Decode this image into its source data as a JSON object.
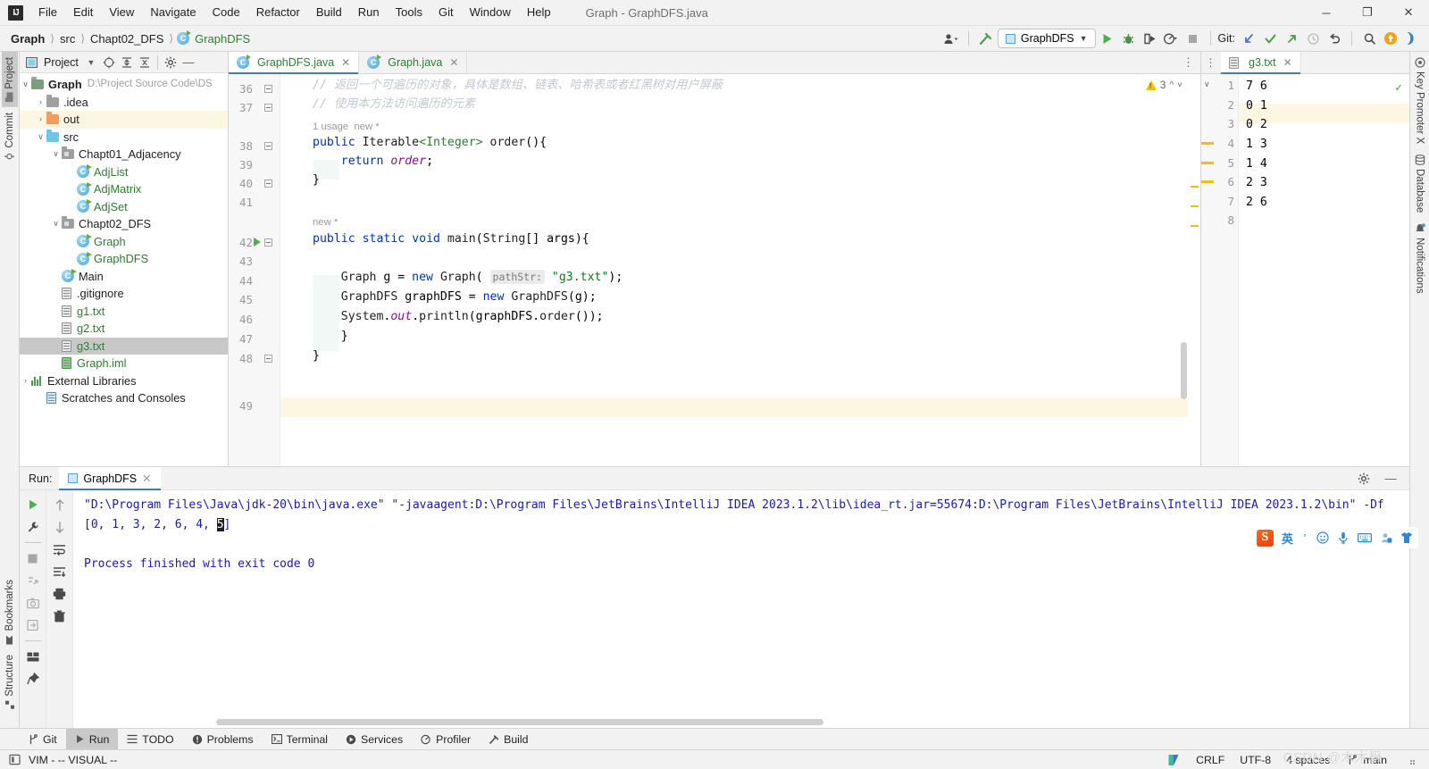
{
  "window": {
    "title": "Graph - GraphDFS.java",
    "logo": "IJ",
    "controls": {
      "minimize": "─",
      "maximize": "❐",
      "close": "✕"
    }
  },
  "menu": [
    "File",
    "Edit",
    "View",
    "Navigate",
    "Code",
    "Refactor",
    "Build",
    "Run",
    "Tools",
    "Git",
    "Window",
    "Help"
  ],
  "breadcrumb": {
    "project": "Graph",
    "src": "src",
    "package": "Chapt02_DFS",
    "class": "GraphDFS"
  },
  "toolbar": {
    "run_config": "GraphDFS",
    "git_label": "Git:",
    "icons": [
      "user-avatar-icon",
      "build-hammer-icon",
      "run-icon",
      "debug-icon",
      "run-with-coverage-icon",
      "profiler-icon",
      "stop-icon",
      "git-update-icon",
      "git-commit-icon",
      "git-push-icon",
      "history-icon",
      "rollback-icon",
      "search-everywhere-icon",
      "update-icon",
      "ide-assistant-icon"
    ]
  },
  "left_stripe": [
    {
      "label": "Project",
      "icon": "project-folder-icon",
      "selected": true
    },
    {
      "label": "Commit",
      "icon": "commit-icon",
      "selected": false
    },
    {
      "label": "Bookmarks",
      "icon": "bookmark-icon",
      "selected": false
    },
    {
      "label": "Structure",
      "icon": "structure-icon",
      "selected": false
    }
  ],
  "right_stripe": [
    {
      "label": "Key Promoter X",
      "icon": "key-promoter-icon"
    },
    {
      "label": "Database",
      "icon": "database-icon"
    },
    {
      "label": "Notifications",
      "icon": "notifications-bell-icon"
    }
  ],
  "project_panel": {
    "title": "Project",
    "toolbar_icons": [
      "select-opened-file-icon",
      "expand-all-icon",
      "collapse-all-icon",
      "settings-gear-icon",
      "hide-icon"
    ],
    "tree": [
      {
        "label": "Graph",
        "detail": "D:\\Project Source Code\\DS",
        "kind": "project-root",
        "indent": 0,
        "arrow": "∨",
        "bold": true
      },
      {
        "label": ".idea",
        "kind": "folder-gray",
        "indent": 1,
        "arrow": "›"
      },
      {
        "label": "out",
        "kind": "folder-orange",
        "indent": 1,
        "arrow": "›",
        "highlight": true
      },
      {
        "label": "src",
        "kind": "folder-src",
        "indent": 1,
        "arrow": "∨"
      },
      {
        "label": "Chapt01_Adjacency",
        "kind": "package",
        "indent": 2,
        "arrow": "∨"
      },
      {
        "label": "AdjList",
        "kind": "class",
        "indent": 3
      },
      {
        "label": "AdjMatrix",
        "kind": "class",
        "indent": 3
      },
      {
        "label": "AdjSet",
        "kind": "class",
        "indent": 3
      },
      {
        "label": "Chapt02_DFS",
        "kind": "package",
        "indent": 2,
        "arrow": "∨"
      },
      {
        "label": "Graph",
        "kind": "class",
        "indent": 3
      },
      {
        "label": "GraphDFS",
        "kind": "class",
        "indent": 3
      },
      {
        "label": "Main",
        "kind": "class",
        "indent": 2
      },
      {
        "label": ".gitignore",
        "kind": "gitignore-file",
        "indent": 2
      },
      {
        "label": "g1.txt",
        "kind": "text-file",
        "indent": 2
      },
      {
        "label": "g2.txt",
        "kind": "text-file",
        "indent": 2
      },
      {
        "label": "g3.txt",
        "kind": "text-file",
        "indent": 2,
        "selected": true
      },
      {
        "label": "Graph.iml",
        "kind": "iml-file",
        "indent": 2
      },
      {
        "label": "External Libraries",
        "kind": "libraries",
        "indent": 0,
        "arrow": "›"
      },
      {
        "label": "Scratches and Consoles",
        "kind": "scratches",
        "indent": 0
      }
    ]
  },
  "editor": {
    "tabs": [
      {
        "label": "GraphDFS.java",
        "active": true
      },
      {
        "label": "Graph.java",
        "active": false
      }
    ],
    "warning_count": "3",
    "lines": [
      {
        "num": "36",
        "text": "// 返回一个可遍历的对象，具体是数组、链表、哈希表或者红黑树对用户屏蔽"
      },
      {
        "num": "37",
        "text": "// 使用本方法访问遍历的元素"
      },
      {
        "num": "38",
        "text": "public Iterable<Integer> order(){"
      },
      {
        "num": "39",
        "text": "    return order;"
      },
      {
        "num": "40",
        "text": "}"
      },
      {
        "num": "41",
        "text": ""
      },
      {
        "num": "42",
        "text": "public static void main(String[] args){"
      },
      {
        "num": "43",
        "text": ""
      },
      {
        "num": "44",
        "text": "    Graph g = new Graph( pathStr: \"g3.txt\");"
      },
      {
        "num": "45",
        "text": "    GraphDFS graphDFS = new GraphDFS(g);"
      },
      {
        "num": "46",
        "text": "    System.out.println(graphDFS.order());"
      },
      {
        "num": "47",
        "text": "    }"
      },
      {
        "num": "48",
        "text": "}"
      },
      {
        "num": "49",
        "text": ""
      }
    ],
    "inlay_usage": "1 usage",
    "inlay_new": "new *",
    "inlay_new2": "new *",
    "param_hint": "pathStr:"
  },
  "right_editor": {
    "tab": "g3.txt",
    "lines": [
      {
        "num": "1",
        "text": "7 6"
      },
      {
        "num": "2",
        "text": "0 1"
      },
      {
        "num": "3",
        "text": "0 2",
        "highlight": true
      },
      {
        "num": "4",
        "text": "1 3"
      },
      {
        "num": "5",
        "text": "1 4"
      },
      {
        "num": "6",
        "text": "2 3"
      },
      {
        "num": "7",
        "text": "2 6"
      },
      {
        "num": "8",
        "text": ""
      }
    ]
  },
  "run_panel": {
    "label": "Run:",
    "tab": "GraphDFS",
    "left_icons": [
      "rerun-icon",
      "settings-wrench-icon",
      "stop-icon",
      "rerun-failed-icon",
      "screenshot-icon",
      "export-icon",
      "layout-icon",
      "pin-icon"
    ],
    "nav_icons": [
      "up-arrow-icon",
      "down-arrow-icon",
      "soft-wrap-icon",
      "scroll-to-end-icon",
      "print-icon",
      "trash-icon"
    ],
    "head_right_icons": [
      "settings-gear-icon",
      "hide-icon"
    ],
    "output": [
      {
        "text": "\"D:\\Program Files\\Java\\jdk-20\\bin\\java.exe\" \"-javaagent:D:\\Program Files\\JetBrains\\IntelliJ IDEA 2023.1.2\\lib\\idea_rt.jar=55674:D:\\Program Files\\JetBrains\\IntelliJ IDEA 2023.1.2\\bin\" -Df"
      },
      {
        "text": "[0, 1, 3, 2, 6, 4, 5]",
        "selection": "5"
      },
      {
        "text": ""
      },
      {
        "text": "Process finished with exit code 0"
      }
    ]
  },
  "ime": {
    "logo": "S",
    "mode": "英",
    "icons": [
      "punctuation-icon",
      "emoji-icon",
      "voice-input-icon",
      "soft-keyboard-icon",
      "user-icon",
      "skin-icon"
    ]
  },
  "tool_windows": [
    {
      "label": "Git",
      "icon": "git-branch-icon",
      "selected": false
    },
    {
      "label": "Run",
      "icon": "run-icon",
      "selected": true
    },
    {
      "label": "TODO",
      "icon": "todo-icon",
      "selected": false
    },
    {
      "label": "Problems",
      "icon": "problems-icon",
      "selected": false
    },
    {
      "label": "Terminal",
      "icon": "terminal-icon",
      "selected": false
    },
    {
      "label": "Services",
      "icon": "services-icon",
      "selected": false
    },
    {
      "label": "Profiler",
      "icon": "profiler-icon",
      "selected": false
    },
    {
      "label": "Build",
      "icon": "build-hammer-icon",
      "selected": false
    }
  ],
  "status_bar": {
    "vim": "VIM - -- VISUAL --",
    "line_separator": "CRLF",
    "encoding": "UTF-8",
    "indent": "4 spaces",
    "branch": "main"
  },
  "watermark": "CSDN @木木枫",
  "colors": {
    "accent": "#3f7ac9",
    "keyword": "#0033b3",
    "string": "#067d17",
    "comment": "#c3c7cf",
    "console": "#1a1aa6",
    "green": "#2e7d32",
    "warning": "#f2c200"
  }
}
